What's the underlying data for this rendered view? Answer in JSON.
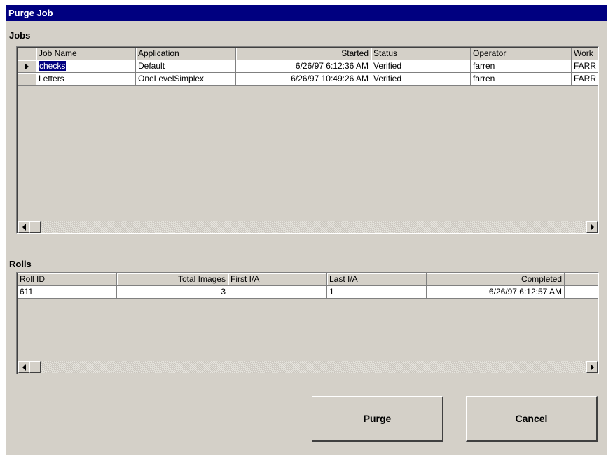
{
  "window": {
    "title": "Purge Job"
  },
  "jobs": {
    "label": "Jobs",
    "columns": [
      "Job Name",
      "Application",
      "Started",
      "Status",
      "Operator",
      "Work"
    ],
    "rows": [
      {
        "job_name": "checks",
        "application": "Default",
        "started": "6/26/97 6:12:36 AM",
        "status": "Verified",
        "operator": "farren",
        "work": "FARR"
      },
      {
        "job_name": "Letters",
        "application": "OneLevelSimplex",
        "started": "6/26/97 10:49:26 AM",
        "status": "Verified",
        "operator": "farren",
        "work": "FARR"
      }
    ]
  },
  "rolls": {
    "label": "Rolls",
    "columns": [
      "Roll ID",
      "Total Images",
      "First I/A",
      "Last I/A",
      "Completed"
    ],
    "rows": [
      {
        "roll_id": "611",
        "total_images": "3",
        "first_ia": "",
        "last_ia": "1",
        "completed": "6/26/97 6:12:57 AM"
      }
    ]
  },
  "buttons": {
    "purge": "Purge",
    "cancel": "Cancel"
  },
  "colors": {
    "titlebar": "#000080",
    "face": "#d4d0c8",
    "selection": "#000080"
  },
  "icons": {
    "row_pointer": "triangle-right-icon",
    "scroll_left": "arrow-left-icon",
    "scroll_right": "arrow-right-icon"
  }
}
